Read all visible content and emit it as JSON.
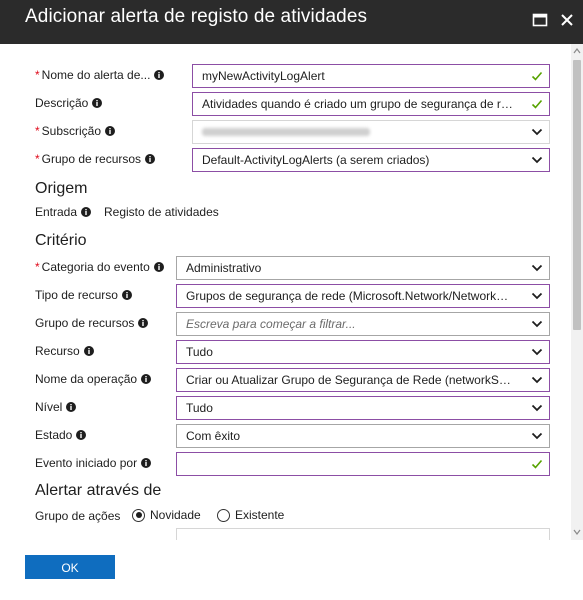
{
  "window": {
    "title": "Adicionar alerta de registo de atividades"
  },
  "form": {
    "alert_name": {
      "label": "Nome do alerta de...",
      "value": "myNewActivityLogAlert"
    },
    "description": {
      "label": "Descrição",
      "value": "Atividades quando é criado um grupo de segurança de rede."
    },
    "subscription": {
      "label": "Subscrição"
    },
    "resource_group_top": {
      "label": "Grupo de recursos",
      "value": "Default-ActivityLogAlerts (a serem criados)"
    }
  },
  "origin": {
    "heading": "Origem",
    "entry_label": "Entrada",
    "entry_value": "Registo de atividades"
  },
  "criteria": {
    "heading": "Critério",
    "event_category": {
      "label": "Categoria do evento",
      "value": "Administrativo"
    },
    "resource_type": {
      "label": "Tipo de recurso",
      "value": "Grupos de segurança de rede (Microsoft.Network/NetworkSecurityGroups)"
    },
    "resource_group": {
      "label": "Grupo de recursos",
      "placeholder": "Escreva para começar a filtrar..."
    },
    "resource": {
      "label": "Recurso",
      "value": "Tudo"
    },
    "operation_name": {
      "label": "Nome da operação",
      "value": "Criar ou Atualizar Grupo de Segurança de Rede (networkSecurityGroups)"
    },
    "level": {
      "label": "Nível",
      "value": "Tudo"
    },
    "status": {
      "label": "Estado",
      "value": "Com êxito"
    },
    "event_initiated_by": {
      "label": "Evento iniciado por",
      "value": ""
    }
  },
  "alert_via": {
    "heading": "Alertar através de",
    "action_group_label": "Grupo de ações",
    "options": [
      "Novidade",
      "Existente"
    ],
    "selected": "Novidade"
  },
  "footer": {
    "ok_label": "OK"
  },
  "colors": {
    "titlebar": "#2b2b2b",
    "valid_border": "#8c4ea5",
    "check": "#57a300",
    "required": "#e00b1c",
    "ok_button": "#0f6dbf"
  },
  "icons": {
    "valid": "check-icon",
    "dropdown": "chevron-down-icon",
    "info": "info-icon"
  }
}
